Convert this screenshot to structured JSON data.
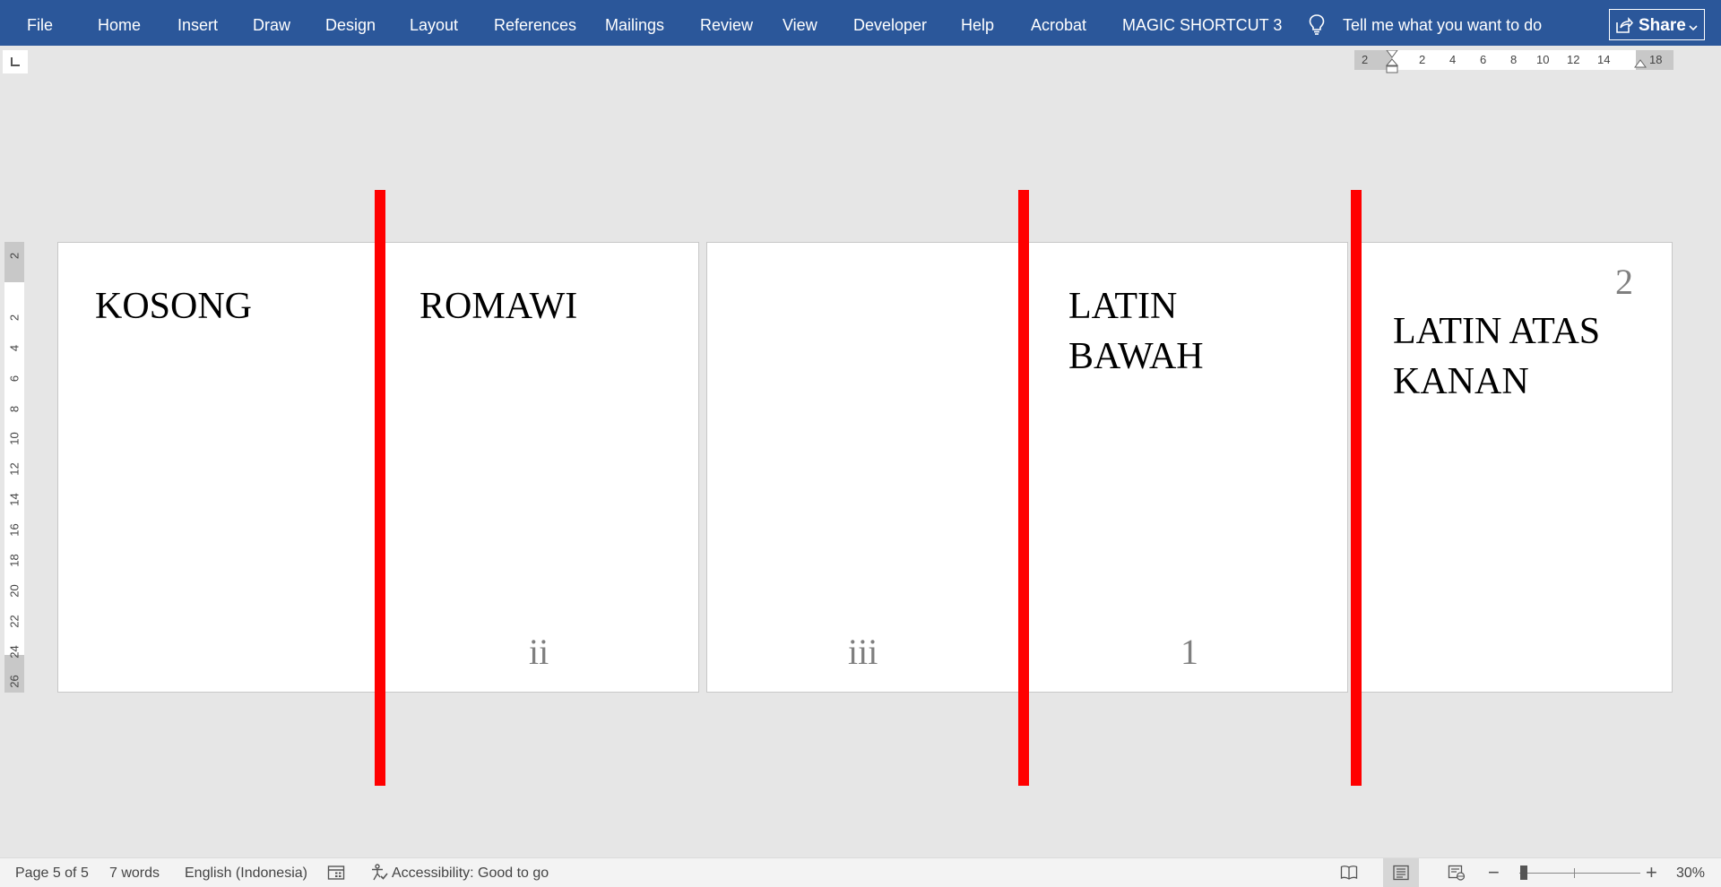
{
  "ribbon": {
    "tabs": [
      "File",
      "Home",
      "Insert",
      "Draw",
      "Design",
      "Layout",
      "References",
      "Mailings",
      "Review",
      "View",
      "Developer",
      "Help",
      "Acrobat",
      "MAGIC SHORTCUT 3"
    ],
    "tell_me": "Tell me what you want to do",
    "share_label": "Share"
  },
  "ruler": {
    "horizontal": [
      "2",
      "2",
      "4",
      "6",
      "8",
      "10",
      "12",
      "14",
      "18"
    ],
    "vertical": [
      "2",
      "2",
      "4",
      "6",
      "8",
      "10",
      "12",
      "14",
      "16",
      "18",
      "20",
      "22",
      "24",
      "26"
    ]
  },
  "pages": [
    {
      "headings": [
        "KOSONG",
        "ROMAWI"
      ],
      "numbers": [
        "ii"
      ]
    },
    {
      "headings": [
        "LATIN",
        "BAWAH"
      ],
      "numbers": [
        "iii",
        "1"
      ]
    },
    {
      "headings": [
        "LATIN ATAS",
        "KANAN"
      ],
      "numbers": [
        "2"
      ]
    }
  ],
  "status": {
    "page": "Page 5 of 5",
    "words": "7 words",
    "language": "English (Indonesia)",
    "accessibility": "Accessibility: Good to go",
    "zoom_percent": "30%",
    "zoom_level": 0.3
  },
  "colors": {
    "ribbon_bg": "#2b579a",
    "divider": "#ff0000",
    "page_number": "#7f7f7f"
  },
  "icons": [
    "lightbulb-icon",
    "share-icon",
    "chevron-down-icon",
    "tab-selector-icon",
    "macro-icon",
    "accessibility-icon",
    "read-mode-icon",
    "print-layout-icon",
    "web-layout-icon"
  ]
}
